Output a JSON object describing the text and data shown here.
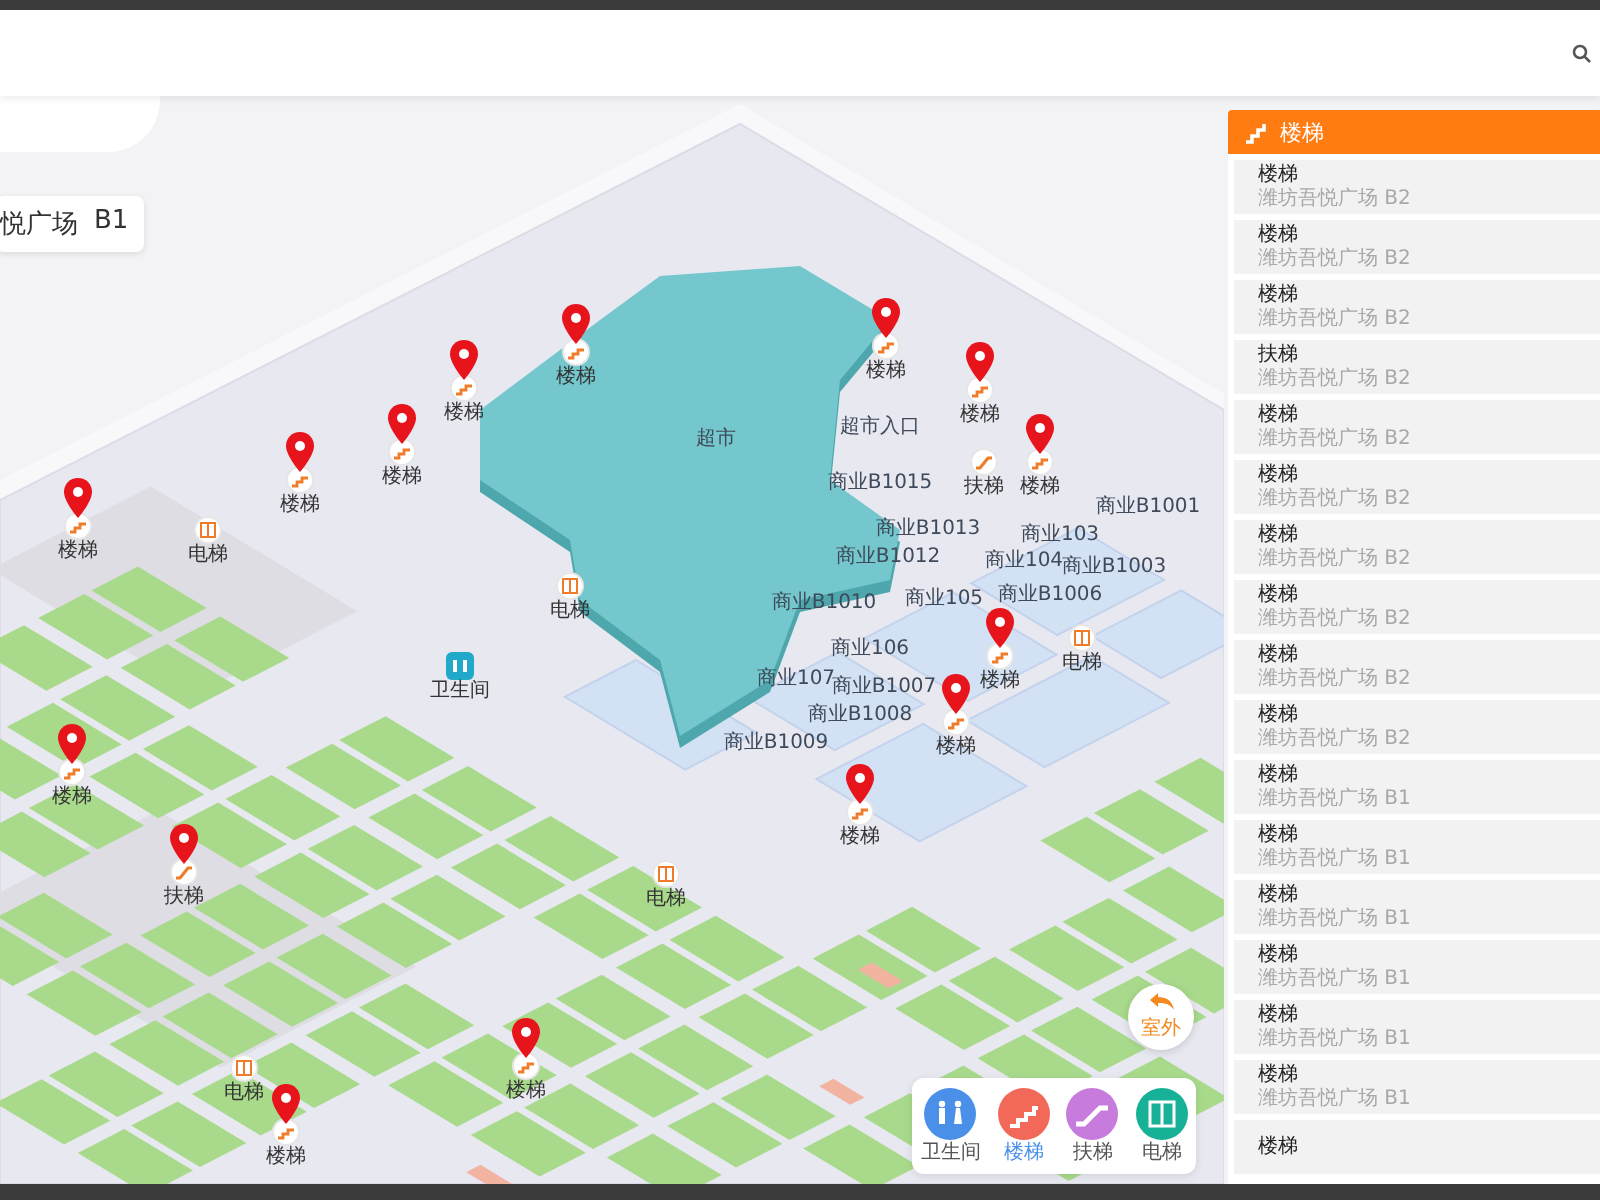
{
  "floor_label": {
    "name": "悦广场",
    "floor": "B1"
  },
  "map": {
    "stores": [
      {
        "label": "超市"
      },
      {
        "label": "超市入口"
      },
      {
        "label": "商业B1015"
      },
      {
        "label": "商业B1013"
      },
      {
        "label": "商业B1012"
      },
      {
        "label": "商业B1010"
      },
      {
        "label": "商业B1001"
      },
      {
        "label": "商业103"
      },
      {
        "label": "商业104"
      },
      {
        "label": "商业B1003"
      },
      {
        "label": "商业105"
      },
      {
        "label": "商业B1006"
      },
      {
        "label": "商业106"
      },
      {
        "label": "商业107"
      },
      {
        "label": "商业B1007"
      },
      {
        "label": "商业B1008"
      },
      {
        "label": "商业B1009"
      }
    ],
    "pois": [
      {
        "kind": "stairs",
        "label": "楼梯",
        "pinned": true
      },
      {
        "kind": "stairs",
        "label": "楼梯",
        "pinned": true
      },
      {
        "kind": "stairs",
        "label": "楼梯",
        "pinned": true
      },
      {
        "kind": "stairs",
        "label": "楼梯",
        "pinned": true
      },
      {
        "kind": "stairs",
        "label": "楼梯",
        "pinned": true
      },
      {
        "kind": "elevator",
        "label": "电梯",
        "pinned": false
      },
      {
        "kind": "elevator",
        "label": "电梯",
        "pinned": false
      },
      {
        "kind": "restroom",
        "label": "卫生间",
        "pinned": false
      },
      {
        "kind": "stairs",
        "label": "楼梯",
        "pinned": true
      },
      {
        "kind": "stairs",
        "label": "楼梯",
        "pinned": true
      },
      {
        "kind": "escalator",
        "label": "扶梯",
        "pinned": false
      },
      {
        "kind": "stairs",
        "label": "楼梯",
        "pinned": true
      },
      {
        "kind": "elevator",
        "label": "电梯",
        "pinned": false
      },
      {
        "kind": "stairs",
        "label": "楼梯",
        "pinned": true
      },
      {
        "kind": "stairs",
        "label": "楼梯",
        "pinned": true
      },
      {
        "kind": "stairs",
        "label": "楼梯",
        "pinned": true
      },
      {
        "kind": "stairs",
        "label": "楼梯",
        "pinned": true
      },
      {
        "kind": "escalator",
        "label": "扶梯",
        "pinned": true
      },
      {
        "kind": "elevator",
        "label": "电梯",
        "pinned": false
      },
      {
        "kind": "elevator",
        "label": "电梯",
        "pinned": false
      },
      {
        "kind": "stairs",
        "label": "楼梯",
        "pinned": true
      },
      {
        "kind": "stairs",
        "label": "楼梯",
        "pinned": true
      }
    ]
  },
  "outdoor_button": {
    "label": "室外"
  },
  "filters": [
    {
      "kind": "restroom",
      "label": "卫生间",
      "selected": false
    },
    {
      "kind": "stairs",
      "label": "楼梯",
      "selected": true
    },
    {
      "kind": "escalator",
      "label": "扶梯",
      "selected": false
    },
    {
      "kind": "elevator",
      "label": "电梯",
      "selected": false
    }
  ],
  "panel": {
    "title": "楼梯",
    "items": [
      {
        "title": "楼梯",
        "subtitle": "潍坊吾悦广场 B2"
      },
      {
        "title": "楼梯",
        "subtitle": "潍坊吾悦广场 B2"
      },
      {
        "title": "楼梯",
        "subtitle": "潍坊吾悦广场 B2"
      },
      {
        "title": "扶梯",
        "subtitle": "潍坊吾悦广场 B2"
      },
      {
        "title": "楼梯",
        "subtitle": "潍坊吾悦广场 B2"
      },
      {
        "title": "楼梯",
        "subtitle": "潍坊吾悦广场 B2"
      },
      {
        "title": "楼梯",
        "subtitle": "潍坊吾悦广场 B2"
      },
      {
        "title": "楼梯",
        "subtitle": "潍坊吾悦广场 B2"
      },
      {
        "title": "楼梯",
        "subtitle": "潍坊吾悦广场 B2"
      },
      {
        "title": "楼梯",
        "subtitle": "潍坊吾悦广场 B2"
      },
      {
        "title": "楼梯",
        "subtitle": "潍坊吾悦广场 B1"
      },
      {
        "title": "楼梯",
        "subtitle": "潍坊吾悦广场 B1"
      },
      {
        "title": "楼梯",
        "subtitle": "潍坊吾悦广场 B1"
      },
      {
        "title": "楼梯",
        "subtitle": "潍坊吾悦广场 B1"
      },
      {
        "title": "楼梯",
        "subtitle": "潍坊吾悦广场 B1"
      },
      {
        "title": "楼梯",
        "subtitle": "潍坊吾悦广场 B1"
      },
      {
        "title": "楼梯"
      }
    ]
  }
}
